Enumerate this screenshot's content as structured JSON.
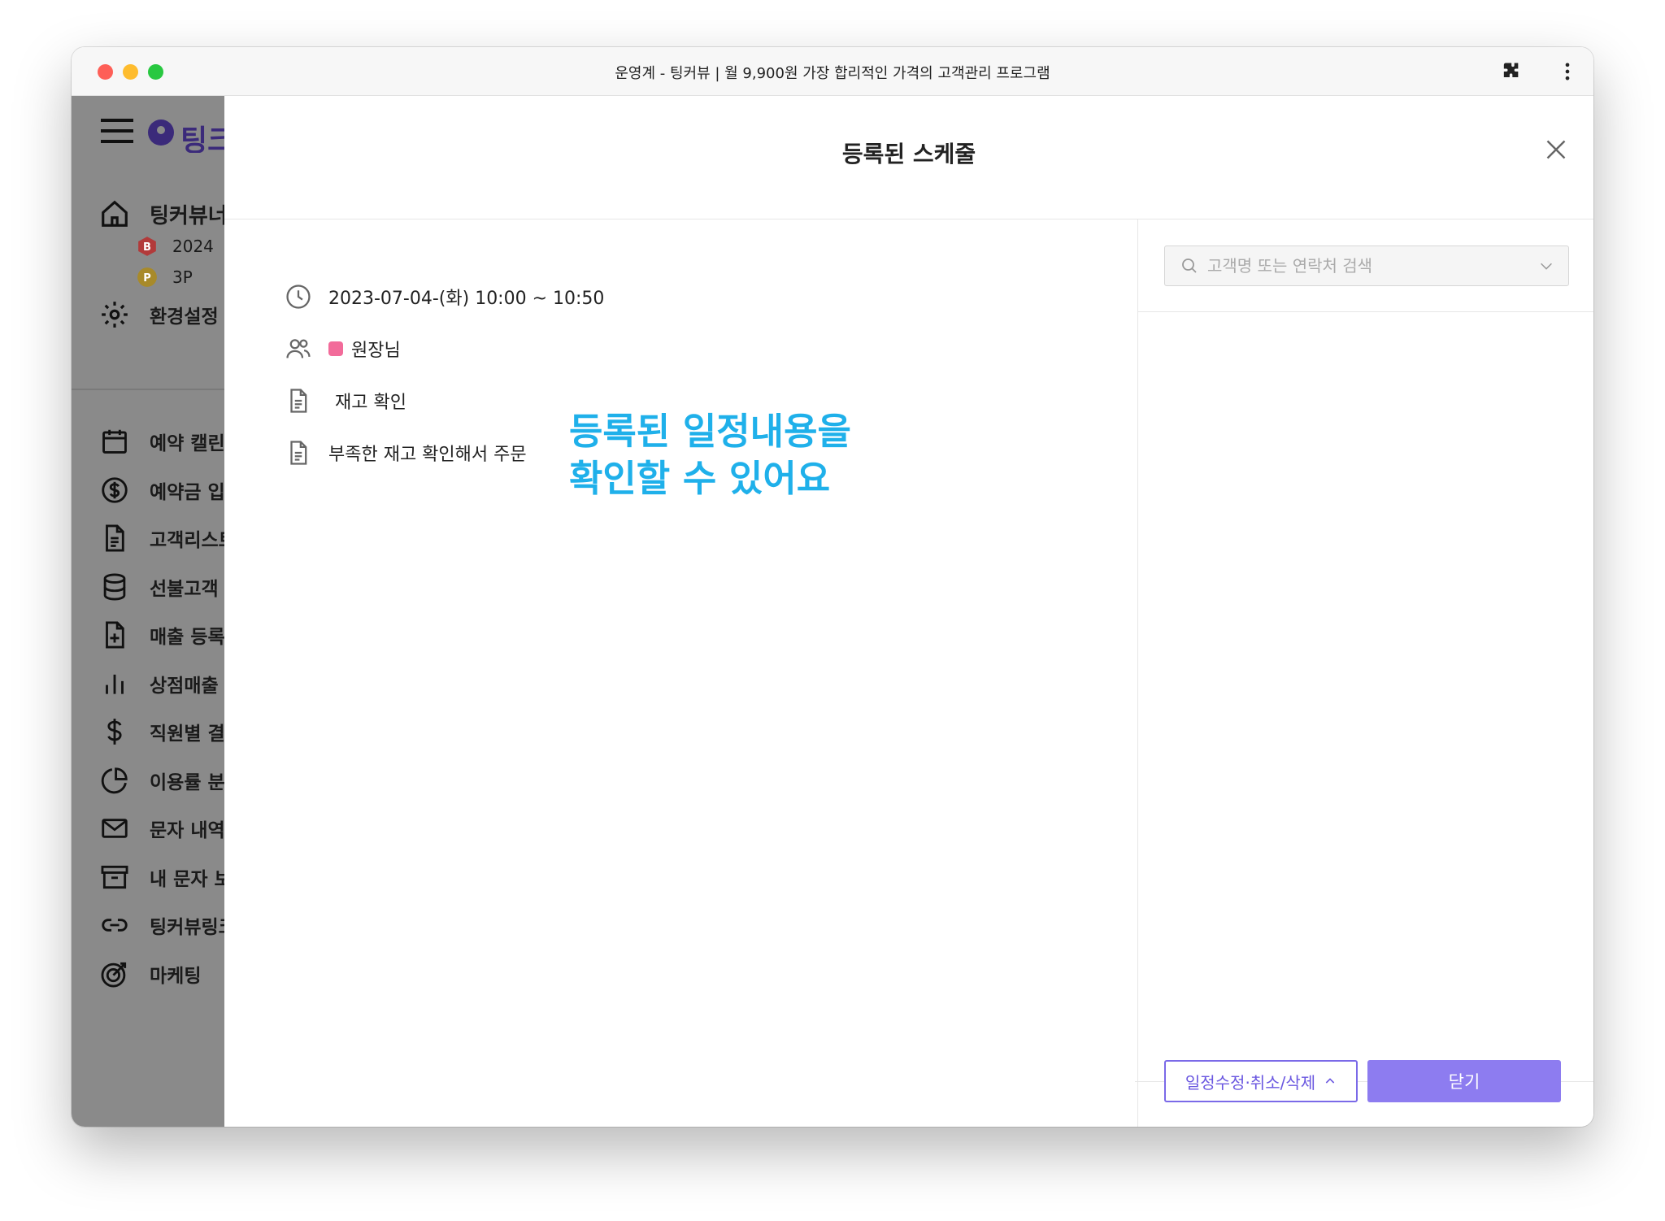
{
  "window": {
    "title": "운영계 - 팅커뷰 | 월 9,900원 가장 합리적인 가격의 고객관리 프로그램"
  },
  "sidebar": {
    "logo_text": "팅크",
    "home_label": "팅커뷰너",
    "badge_b_text": "2024",
    "badge_p_text": "3P",
    "settings_label": "환경설정",
    "items": [
      {
        "label": "예약 캘린",
        "icon": "calendar-icon"
      },
      {
        "label": "예약금 입",
        "icon": "dollar-circle-icon"
      },
      {
        "label": "고객리스트",
        "icon": "document-icon"
      },
      {
        "label": "선불고객",
        "icon": "database-icon"
      },
      {
        "label": "매출 등록",
        "icon": "file-plus-icon"
      },
      {
        "label": "상점매출",
        "icon": "bar-chart-icon"
      },
      {
        "label": "직원별 결",
        "icon": "dollar-icon"
      },
      {
        "label": "이용률 분",
        "icon": "pie-chart-icon"
      },
      {
        "label": "문자 내역",
        "icon": "mail-icon"
      },
      {
        "label": "내 문자 보",
        "icon": "archive-icon"
      },
      {
        "label": "팅커뷰링크",
        "icon": "link-icon"
      },
      {
        "label": "마케팅",
        "icon": "target-icon"
      }
    ]
  },
  "modal": {
    "title": "등록된 스케줄",
    "schedule": {
      "datetime": "2023-07-04-(화) 10:00 ~ 10:50",
      "staff": "원장님",
      "staff_color": "#f26b9a",
      "title": "재고 확인",
      "memo": "부족한 재고 확인해서 주문"
    },
    "annotation_line1": "등록된 일정내용을",
    "annotation_line2": "확인할 수 있어요",
    "search": {
      "placeholder": "고객명 또는 연락처 검색",
      "value": ""
    },
    "edit_button_label": "일정수정·취소/삭제",
    "close_button_label": "닫기"
  },
  "colors": {
    "accent": "#8d7cf0",
    "annotation": "#1fb0ea"
  }
}
